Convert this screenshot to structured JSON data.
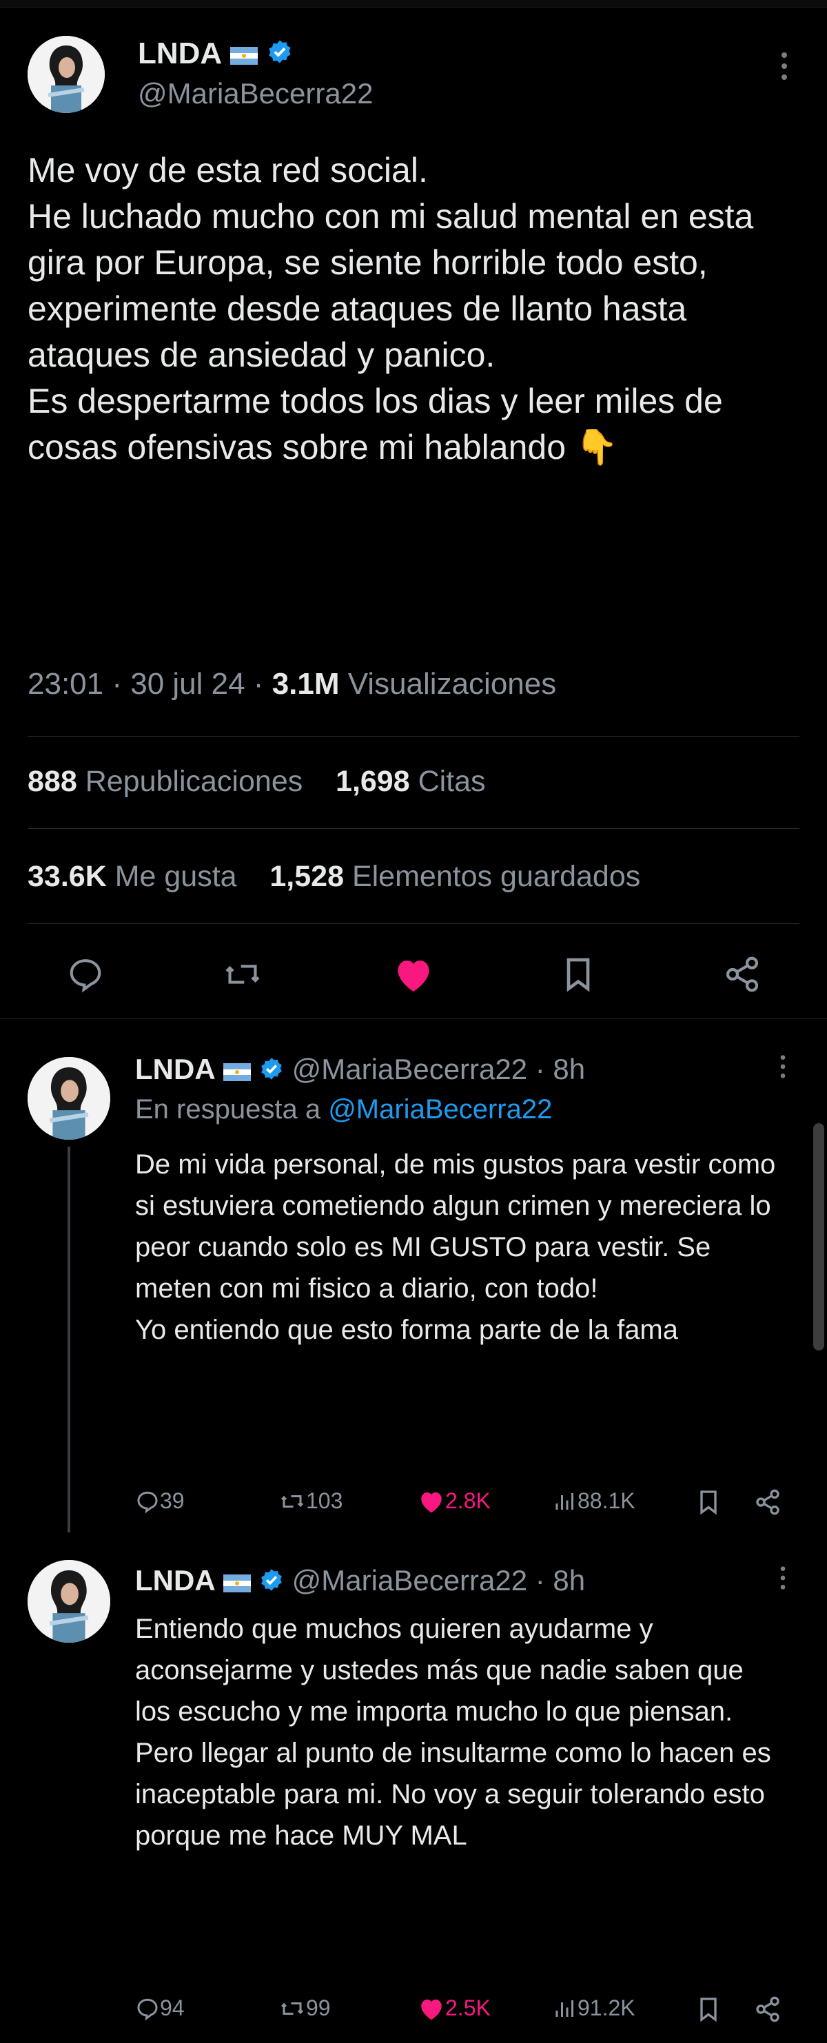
{
  "main_tweet": {
    "display_name": "LNDA",
    "handle": "@MariaBecerra22",
    "text": "Me voy de esta red social.\nHe luchado mucho con mi salud mental en esta gira por Europa, se siente horrible todo esto, experimente desde ataques de llanto hasta ataques de ansiedad y panico.\nEs despertarme todos los dias y leer miles de cosas ofensivas sobre mi hablando",
    "emoji": "👇",
    "time": "23:01",
    "date": "30 jul 24",
    "views_count": "3.1M",
    "views_label": "Visualizaciones",
    "reposts_count": "888",
    "reposts_label": "Republicaciones",
    "quotes_count": "1,698",
    "quotes_label": "Citas",
    "likes_count": "33.6K",
    "likes_label": "Me gusta",
    "bookmarks_count": "1,528",
    "bookmarks_label": "Elementos guardados",
    "like_color": "#f91880"
  },
  "replies": [
    {
      "display_name": "LNDA",
      "handle": "@MariaBecerra22",
      "age": "· 8h",
      "reply_prefix": "En respuesta a ",
      "reply_to": "@MariaBecerra22",
      "text": "De mi vida personal, de mis gustos para vestir como si estuviera cometiendo algun crimen y mereciera lo peor cuando solo es MI GUSTO para vestir. Se meten con mi fisico a diario, con todo!\nYo entiendo que esto forma parte de la fama",
      "comments": "39",
      "reposts": "103",
      "likes": "2.8K",
      "views": "88.1K"
    },
    {
      "display_name": "LNDA",
      "handle": "@MariaBecerra22",
      "age": "· 8h",
      "text": "Entiendo que muchos quieren ayudarme y aconsejarme y ustedes más que nadie saben que los escucho y me importa mucho lo que piensan. Pero llegar al punto de insultarme como lo hacen es inaceptable para mi. No voy a seguir tolerando esto porque me hace MUY MAL",
      "comments": "94",
      "reposts": "99",
      "likes": "2.5K",
      "views": "91.2K"
    }
  ],
  "colors": {
    "accent": "#1d9bf0",
    "like": "#f91880",
    "background": "#000000"
  }
}
